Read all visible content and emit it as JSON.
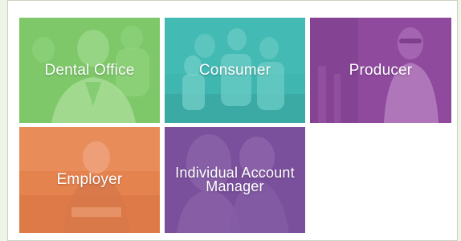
{
  "tiles": [
    {
      "label": "Dental Office",
      "color": "#7ec86a"
    },
    {
      "label": "Consumer",
      "color": "#3fb6b0"
    },
    {
      "label": "Producer",
      "color": "#8f4a9e"
    },
    {
      "label": "Employer",
      "color": "#e5834f"
    },
    {
      "label": "Individual Account Manager",
      "color": "#7a4f9c"
    }
  ]
}
